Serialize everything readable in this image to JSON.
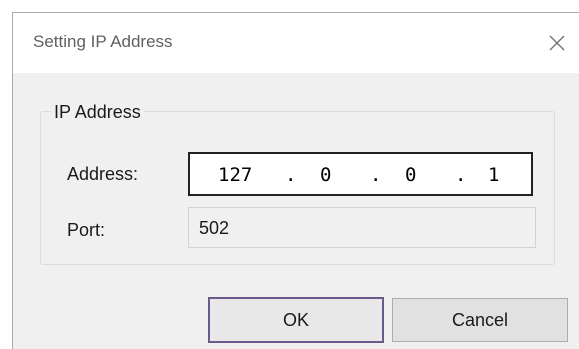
{
  "window": {
    "title": "Setting IP Address"
  },
  "group": {
    "legend": "IP Address"
  },
  "address": {
    "label": "Address:",
    "octets": [
      "127",
      "0",
      "0",
      "1"
    ],
    "separator": "."
  },
  "port": {
    "label": "Port:",
    "value": "502"
  },
  "buttons": {
    "ok": "OK",
    "cancel": "Cancel"
  },
  "icons": {
    "close": "close-icon"
  }
}
